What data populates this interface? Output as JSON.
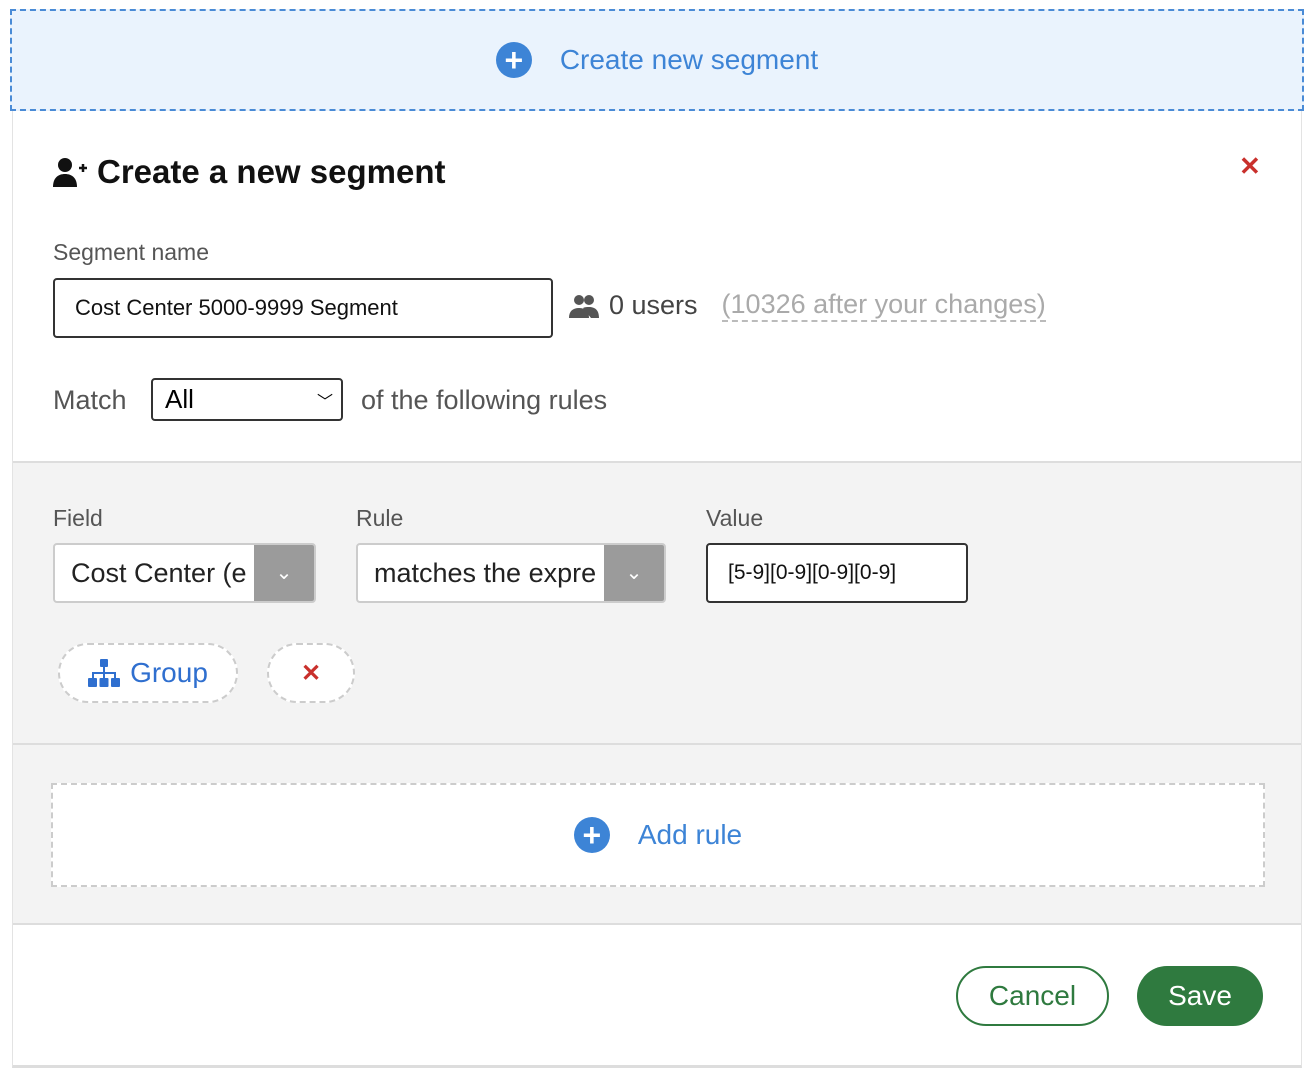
{
  "top": {
    "create_label": "Create new segment"
  },
  "dialog": {
    "title": "Create a new segment",
    "segment_name_label": "Segment name",
    "segment_name_value": "Cost Center 5000-9999 Segment",
    "users_count": "0 users",
    "users_after": "(10326 after your changes)",
    "match_label": "Match",
    "match_value": "All",
    "match_suffix": "of the following rules",
    "rule": {
      "field_label": "Field",
      "field_value": "Cost Center (e",
      "rule_label": "Rule",
      "rule_value": "matches the expre",
      "value_label": "Value",
      "value_value": "[5-9][0-9][0-9][0-9]",
      "group_label": "Group"
    },
    "add_rule_label": "Add rule",
    "cancel_label": "Cancel",
    "save_label": "Save"
  },
  "colors": {
    "accent": "#3d84d6",
    "save": "#2f7a3f",
    "close": "#c9302c"
  }
}
